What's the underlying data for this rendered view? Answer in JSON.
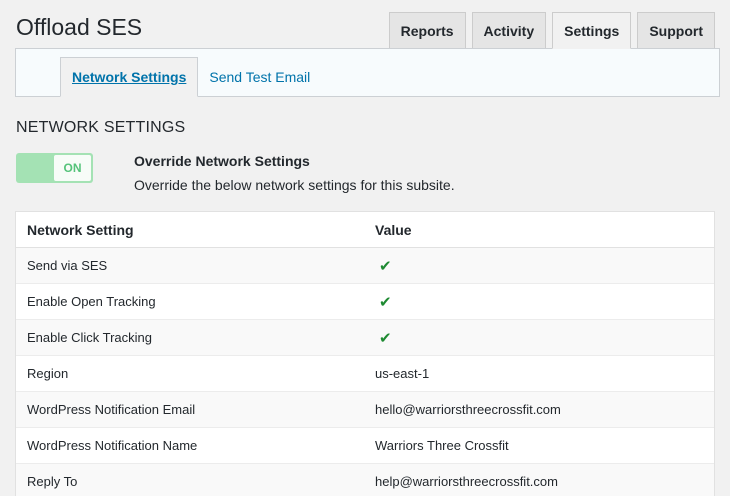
{
  "app": {
    "title": "Offload SES"
  },
  "tabs": [
    {
      "label": "Reports",
      "active": false
    },
    {
      "label": "Activity",
      "active": false
    },
    {
      "label": "Settings",
      "active": true
    },
    {
      "label": "Support",
      "active": false
    }
  ],
  "subnav": [
    {
      "label": "Network Settings",
      "active": true
    },
    {
      "label": "Send Test Email",
      "active": false
    }
  ],
  "section": {
    "heading": "NETWORK SETTINGS"
  },
  "override": {
    "toggle_label": "ON",
    "toggle_state": "on",
    "title": "Override Network Settings",
    "description": "Override the below network settings for this subsite."
  },
  "table": {
    "headers": {
      "name": "Network Setting",
      "value": "Value"
    },
    "rows": [
      {
        "name": "Send via SES",
        "value": "✔",
        "is_check": true
      },
      {
        "name": "Enable Open Tracking",
        "value": "✔",
        "is_check": true
      },
      {
        "name": "Enable Click Tracking",
        "value": "✔",
        "is_check": true
      },
      {
        "name": "Region",
        "value": "us-east-1",
        "is_check": false
      },
      {
        "name": "WordPress Notification Email",
        "value": "hello@warriorsthreecrossfit.com",
        "is_check": false
      },
      {
        "name": "WordPress Notification Name",
        "value": "Warriors Three Crossfit",
        "is_check": false
      },
      {
        "name": "Reply To",
        "value": "help@warriorsthreecrossfit.com",
        "is_check": false
      }
    ]
  },
  "colors": {
    "link": "#0073aa",
    "toggle_on": "#a4e2b4",
    "check": "#1e8a32"
  }
}
